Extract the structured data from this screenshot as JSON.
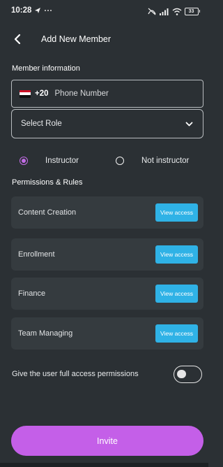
{
  "status_bar": {
    "time": "10:28",
    "battery": "33",
    "icons": [
      "location-arrow-icon",
      "more-dots-icon",
      "signal-icon",
      "wifi-icon",
      "battery-icon"
    ]
  },
  "header": {
    "title": "Add New Member",
    "back_icon": "back-arrow-icon"
  },
  "member_information": {
    "section_title": "Member information",
    "phone": {
      "country_flag": "egypt-flag",
      "dial_code": "+20",
      "placeholder": "Phone Number",
      "value": ""
    },
    "role_select": {
      "placeholder": "Select Role",
      "icon": "chevron-down-icon"
    },
    "role_type": {
      "options": [
        {
          "label": "Instructor",
          "selected": true
        },
        {
          "label": "Not instructor",
          "selected": false
        }
      ],
      "accent_color": "#c26ce6"
    }
  },
  "permissions": {
    "section_title": "Permissions & Rules",
    "items": [
      {
        "name": "Content Creation",
        "button_label": "View access"
      },
      {
        "name": "Enrollment",
        "button_label": "View access"
      },
      {
        "name": "Finance",
        "button_label": "View access"
      },
      {
        "name": "Team Managing",
        "button_label": "View access"
      }
    ],
    "button_color": "#2fb2e6",
    "full_access": {
      "label": "Give the user full access permissions",
      "enabled": false
    }
  },
  "actions": {
    "invite_label": "Invite",
    "invite_color": "#c45fe8"
  },
  "colors": {
    "background": "#2b3034",
    "card": "#353b3f"
  }
}
